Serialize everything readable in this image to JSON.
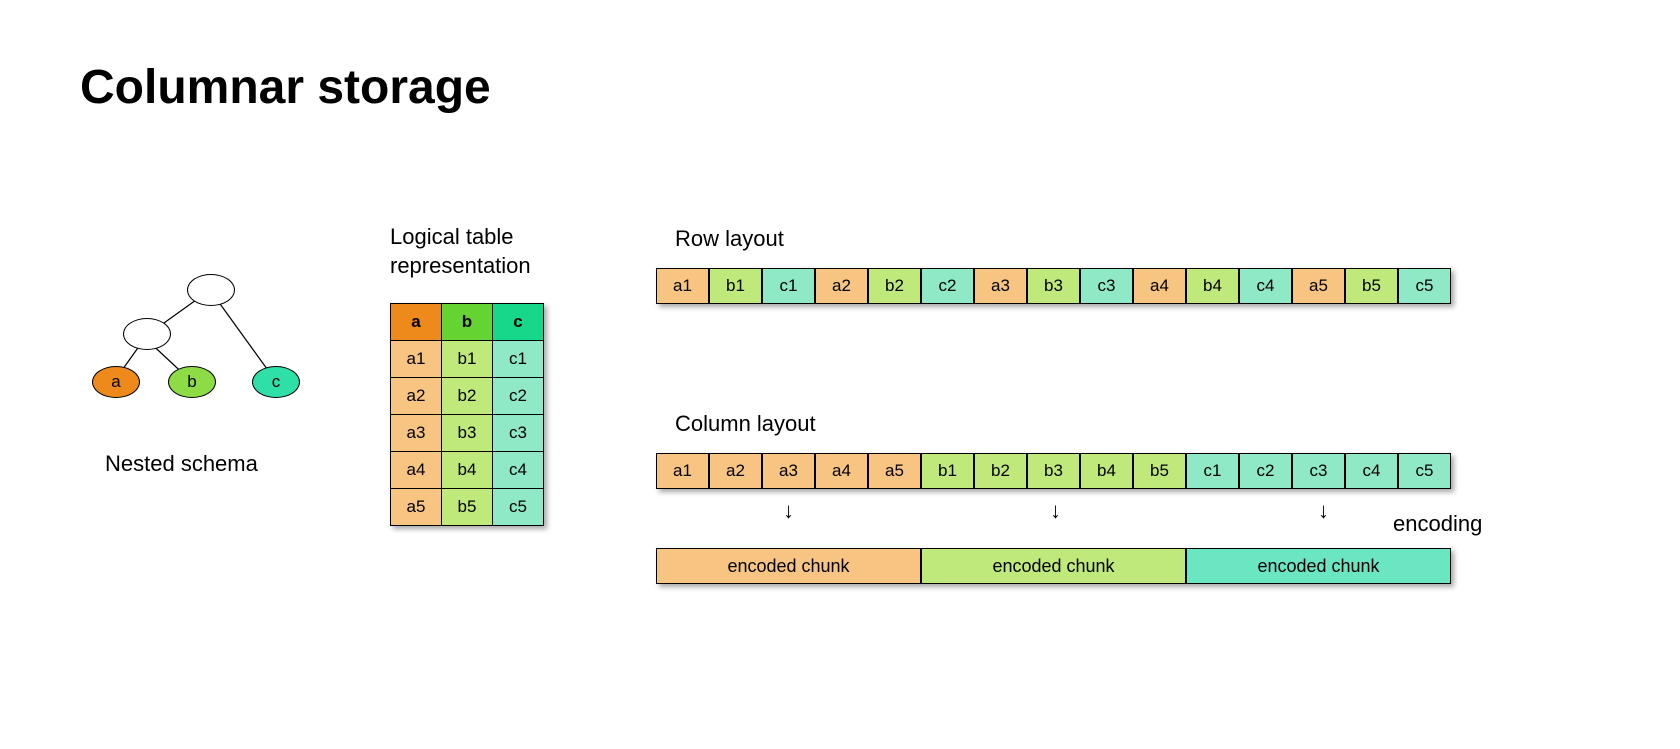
{
  "title": "Columnar storage",
  "nested": {
    "caption": "Nested schema",
    "leaf_a": "a",
    "leaf_b": "b",
    "leaf_c": "c"
  },
  "logical": {
    "caption_line1": "Logical table",
    "caption_line2": "representation",
    "headers": {
      "a": "a",
      "b": "b",
      "c": "c"
    },
    "rows": [
      {
        "a": "a1",
        "b": "b1",
        "c": "c1"
      },
      {
        "a": "a2",
        "b": "b2",
        "c": "c2"
      },
      {
        "a": "a3",
        "b": "b3",
        "c": "c3"
      },
      {
        "a": "a4",
        "b": "b4",
        "c": "c4"
      },
      {
        "a": "a5",
        "b": "b5",
        "c": "c5"
      }
    ]
  },
  "row_layout": {
    "label": "Row layout",
    "cells": [
      {
        "v": "a1",
        "col": "a"
      },
      {
        "v": "b1",
        "col": "b"
      },
      {
        "v": "c1",
        "col": "c"
      },
      {
        "v": "a2",
        "col": "a"
      },
      {
        "v": "b2",
        "col": "b"
      },
      {
        "v": "c2",
        "col": "c"
      },
      {
        "v": "a3",
        "col": "a"
      },
      {
        "v": "b3",
        "col": "b"
      },
      {
        "v": "c3",
        "col": "c"
      },
      {
        "v": "a4",
        "col": "a"
      },
      {
        "v": "b4",
        "col": "b"
      },
      {
        "v": "c4",
        "col": "c"
      },
      {
        "v": "a5",
        "col": "a"
      },
      {
        "v": "b5",
        "col": "b"
      },
      {
        "v": "c5",
        "col": "c"
      }
    ]
  },
  "column_layout": {
    "label": "Column layout",
    "cells": [
      {
        "v": "a1",
        "col": "a"
      },
      {
        "v": "a2",
        "col": "a"
      },
      {
        "v": "a3",
        "col": "a"
      },
      {
        "v": "a4",
        "col": "a"
      },
      {
        "v": "a5",
        "col": "a"
      },
      {
        "v": "b1",
        "col": "b"
      },
      {
        "v": "b2",
        "col": "b"
      },
      {
        "v": "b3",
        "col": "b"
      },
      {
        "v": "b4",
        "col": "b"
      },
      {
        "v": "b5",
        "col": "b"
      },
      {
        "v": "c1",
        "col": "c"
      },
      {
        "v": "c2",
        "col": "c"
      },
      {
        "v": "c3",
        "col": "c"
      },
      {
        "v": "c4",
        "col": "c"
      },
      {
        "v": "c5",
        "col": "c"
      }
    ]
  },
  "encoding": {
    "label": "encoding",
    "chunks": [
      {
        "label": "encoded chunk",
        "col": "a"
      },
      {
        "label": "encoded chunk",
        "col": "b"
      },
      {
        "label": "encoded chunk",
        "col": "c"
      }
    ]
  },
  "colors": {
    "a_dark": "#ee8a1c",
    "a_light": "#f7c581",
    "b_dark": "#65d433",
    "b_light": "#bfe97a",
    "c_dark": "#17d78b",
    "c_light": "#8fe9c7"
  }
}
